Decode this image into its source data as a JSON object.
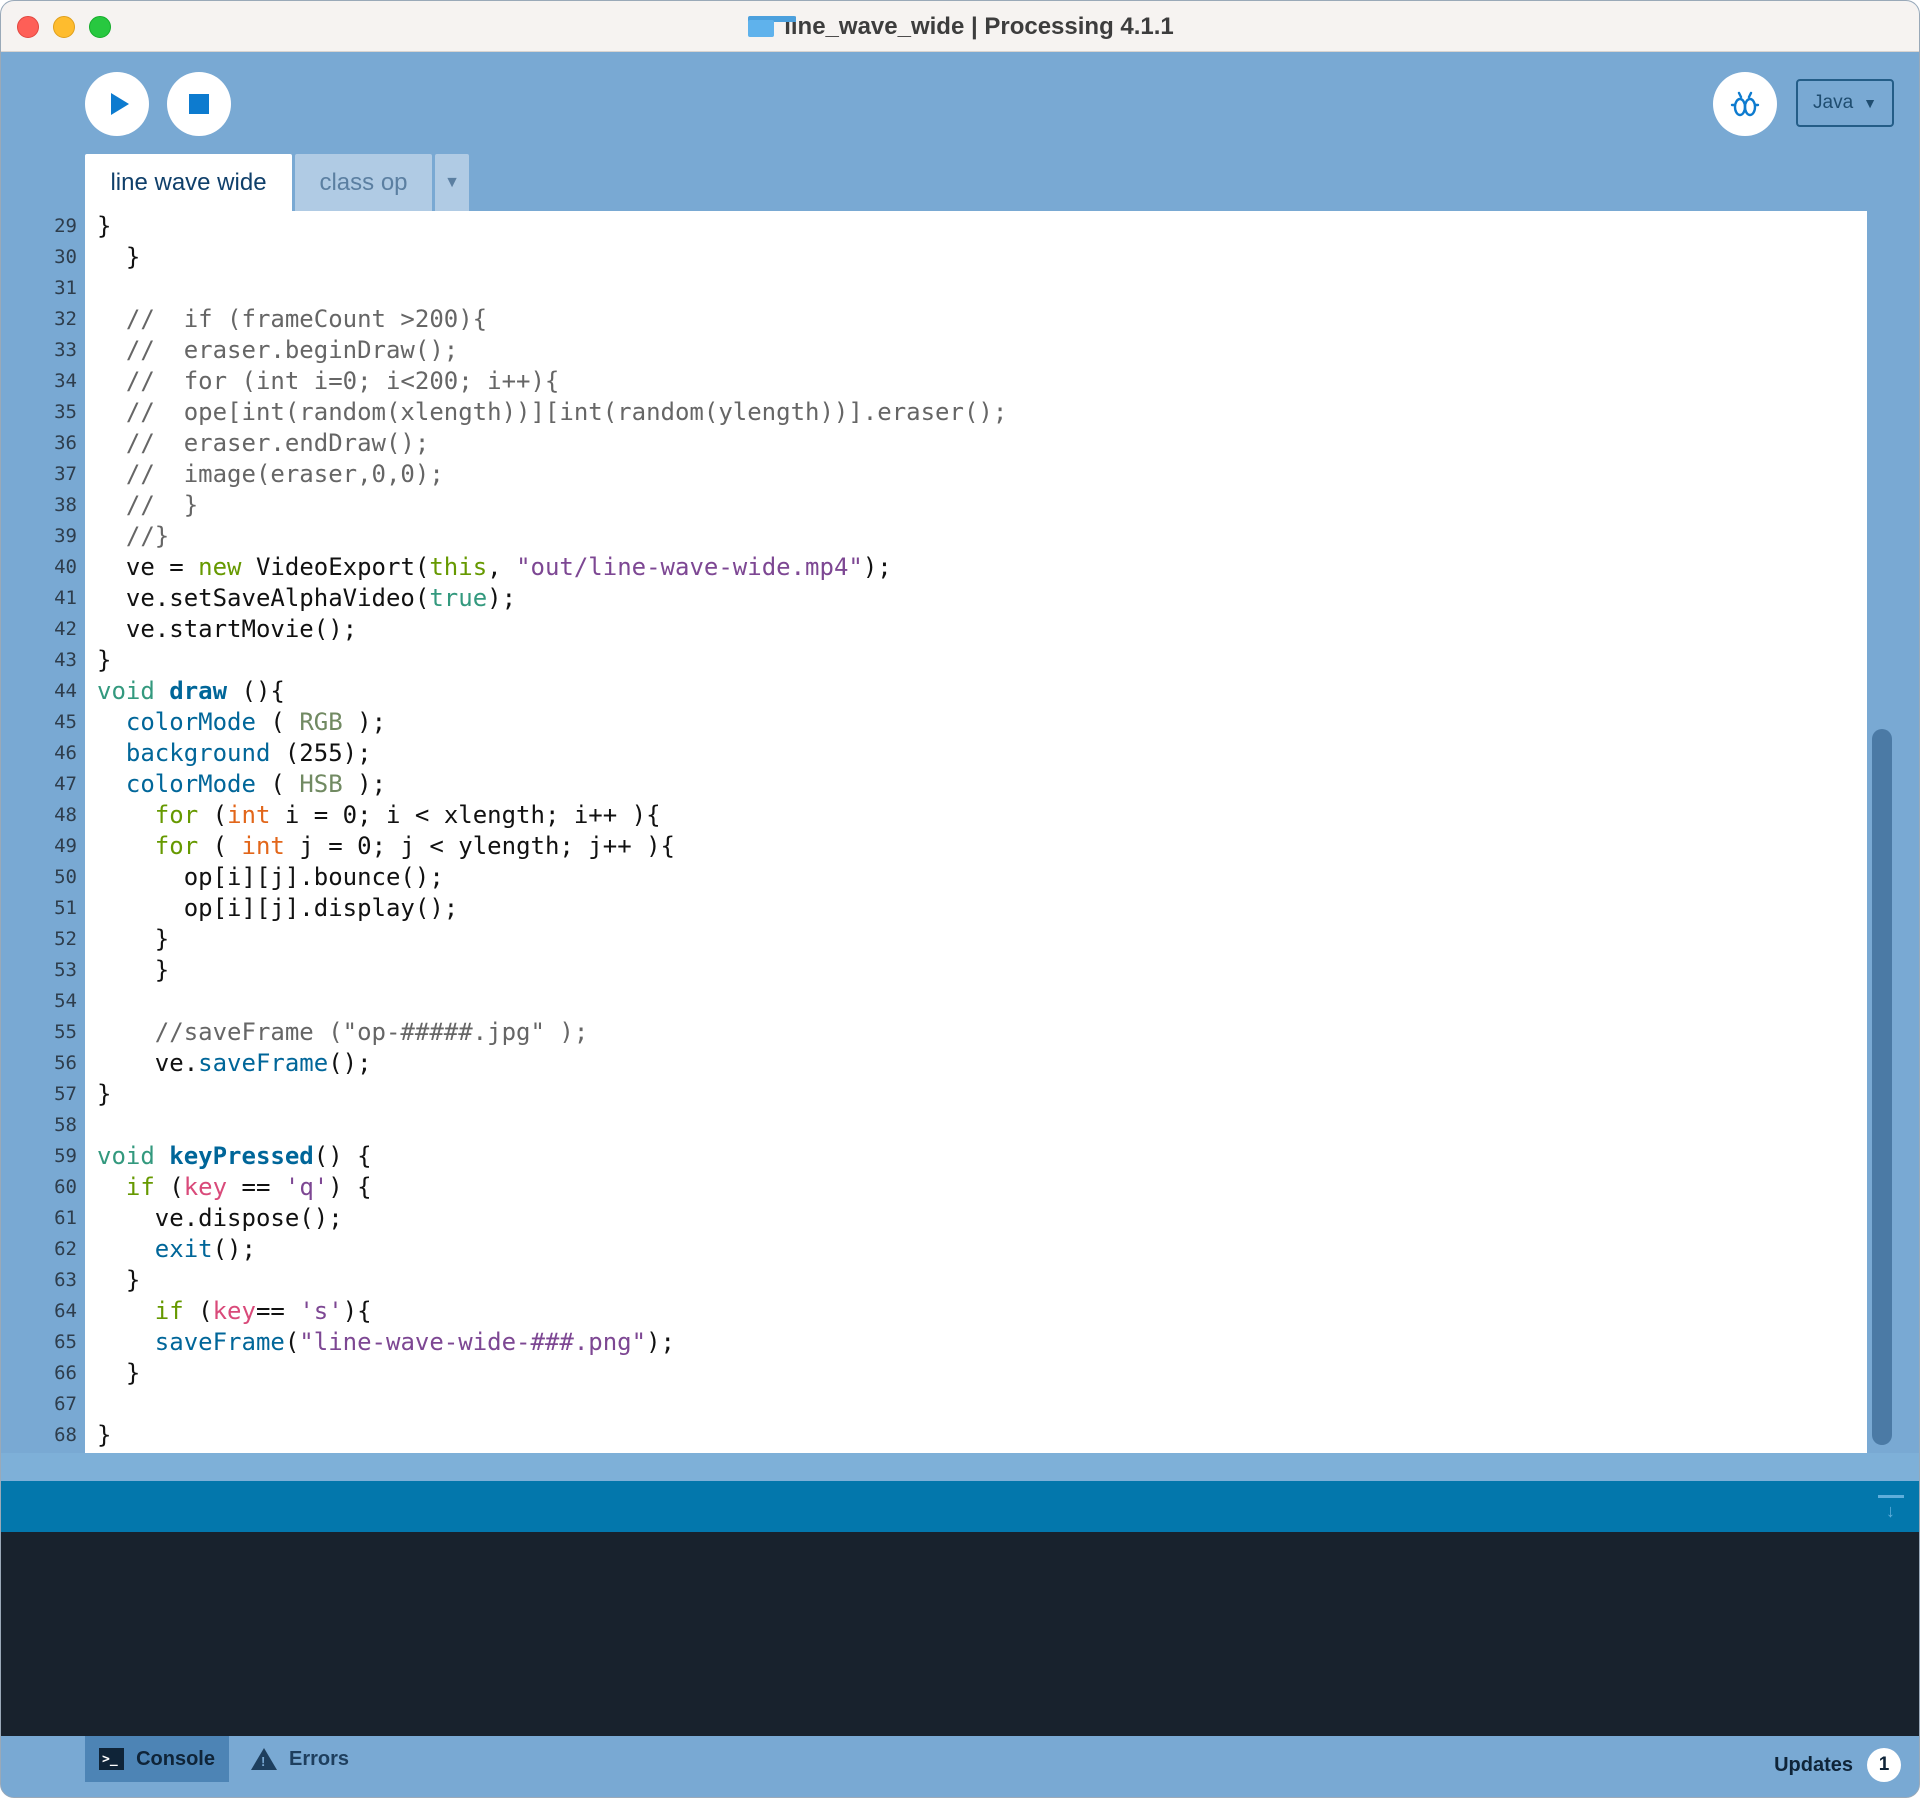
{
  "window": {
    "title": "line_wave_wide | Processing 4.1.1"
  },
  "toolbar": {
    "run_icon": "play-icon",
    "stop_icon": "stop-icon",
    "debug_icon": "debugger-icon",
    "mode_label": "Java",
    "mode_arrow": "▼"
  },
  "tabs": {
    "items": [
      {
        "label": "line wave wide",
        "active": true
      },
      {
        "label": "class op",
        "active": false
      }
    ],
    "menu_arrow": "▼"
  },
  "editor": {
    "lines": [
      {
        "n": "29",
        "segs": [
          {
            "t": "}"
          }
        ]
      },
      {
        "n": "30",
        "segs": [
          {
            "t": "  }"
          }
        ]
      },
      {
        "n": "31",
        "segs": [
          {
            "t": ""
          }
        ]
      },
      {
        "n": "32",
        "segs": [
          {
            "t": "  //  if (frameCount >200){",
            "c": "comment"
          }
        ]
      },
      {
        "n": "33",
        "segs": [
          {
            "t": "  //  eraser.beginDraw();",
            "c": "comment"
          }
        ]
      },
      {
        "n": "34",
        "segs": [
          {
            "t": "  //  for (int i=0; i<200; i++){",
            "c": "comment"
          }
        ]
      },
      {
        "n": "35",
        "segs": [
          {
            "t": "  //  ope[int(random(xlength))][int(random(ylength))].eraser();",
            "c": "comment"
          }
        ]
      },
      {
        "n": "36",
        "segs": [
          {
            "t": "  //  eraser.endDraw();",
            "c": "comment"
          }
        ]
      },
      {
        "n": "37",
        "segs": [
          {
            "t": "  //  image(eraser,0,0);",
            "c": "comment"
          }
        ]
      },
      {
        "n": "38",
        "segs": [
          {
            "t": "  //  }",
            "c": "comment"
          }
        ]
      },
      {
        "n": "39",
        "segs": [
          {
            "t": "  //}",
            "c": "comment"
          }
        ]
      },
      {
        "n": "40",
        "segs": [
          {
            "t": "  ve = "
          },
          {
            "t": "new",
            "c": "kw1"
          },
          {
            "t": " VideoExport("
          },
          {
            "t": "this",
            "c": "kw1"
          },
          {
            "t": ", "
          },
          {
            "t": "\"out/line-wave-wide.mp4\"",
            "c": "str"
          },
          {
            "t": ");"
          }
        ]
      },
      {
        "n": "41",
        "segs": [
          {
            "t": "  ve.setSaveAlphaVideo("
          },
          {
            "t": "true",
            "c": "lit"
          },
          {
            "t": ");"
          }
        ]
      },
      {
        "n": "42",
        "segs": [
          {
            "t": "  ve.startMovie();"
          }
        ]
      },
      {
        "n": "43",
        "segs": [
          {
            "t": "}"
          }
        ]
      },
      {
        "n": "44",
        "segs": [
          {
            "t": "void",
            "c": "kw2"
          },
          {
            "t": " "
          },
          {
            "t": "draw",
            "c": "fnbold"
          },
          {
            "t": " (){"
          }
        ]
      },
      {
        "n": "45",
        "segs": [
          {
            "t": "  "
          },
          {
            "t": "colorMode",
            "c": "fn"
          },
          {
            "t": " ( "
          },
          {
            "t": "RGB",
            "c": "const"
          },
          {
            "t": " );"
          }
        ]
      },
      {
        "n": "46",
        "segs": [
          {
            "t": "  "
          },
          {
            "t": "background",
            "c": "fn"
          },
          {
            "t": " (255);"
          }
        ]
      },
      {
        "n": "47",
        "segs": [
          {
            "t": "  "
          },
          {
            "t": "colorMode",
            "c": "fn"
          },
          {
            "t": " ( "
          },
          {
            "t": "HSB",
            "c": "const"
          },
          {
            "t": " );"
          }
        ]
      },
      {
        "n": "48",
        "segs": [
          {
            "t": "    "
          },
          {
            "t": "for",
            "c": "kw1"
          },
          {
            "t": " ("
          },
          {
            "t": "int",
            "c": "type"
          },
          {
            "t": " i = 0; i < xlength; i++ ){"
          }
        ]
      },
      {
        "n": "49",
        "segs": [
          {
            "t": "    "
          },
          {
            "t": "for",
            "c": "kw1"
          },
          {
            "t": " ( "
          },
          {
            "t": "int",
            "c": "type"
          },
          {
            "t": " j = 0; j < ylength; j++ ){"
          }
        ]
      },
      {
        "n": "50",
        "segs": [
          {
            "t": "      op[i][j].bounce();"
          }
        ]
      },
      {
        "n": "51",
        "segs": [
          {
            "t": "      op[i][j].display();"
          }
        ]
      },
      {
        "n": "52",
        "segs": [
          {
            "t": "    }"
          }
        ]
      },
      {
        "n": "53",
        "segs": [
          {
            "t": "    }"
          }
        ]
      },
      {
        "n": "54",
        "segs": [
          {
            "t": ""
          }
        ]
      },
      {
        "n": "55",
        "segs": [
          {
            "t": "    //saveFrame (\"op-#####.jpg\" );",
            "c": "comment"
          }
        ]
      },
      {
        "n": "56",
        "segs": [
          {
            "t": "    ve."
          },
          {
            "t": "saveFrame",
            "c": "fn"
          },
          {
            "t": "();"
          }
        ]
      },
      {
        "n": "57",
        "segs": [
          {
            "t": "}"
          }
        ]
      },
      {
        "n": "58",
        "segs": [
          {
            "t": ""
          }
        ]
      },
      {
        "n": "59",
        "segs": [
          {
            "t": "void",
            "c": "kw2"
          },
          {
            "t": " "
          },
          {
            "t": "keyPressed",
            "c": "fnbold"
          },
          {
            "t": "() {"
          }
        ]
      },
      {
        "n": "60",
        "segs": [
          {
            "t": "  "
          },
          {
            "t": "if",
            "c": "kw1"
          },
          {
            "t": " ("
          },
          {
            "t": "key",
            "c": "var"
          },
          {
            "t": " == "
          },
          {
            "t": "'q'",
            "c": "str"
          },
          {
            "t": ") {"
          }
        ]
      },
      {
        "n": "61",
        "segs": [
          {
            "t": "    ve.dispose();"
          }
        ]
      },
      {
        "n": "62",
        "segs": [
          {
            "t": "    "
          },
          {
            "t": "exit",
            "c": "fn"
          },
          {
            "t": "();"
          }
        ]
      },
      {
        "n": "63",
        "segs": [
          {
            "t": "  }"
          }
        ]
      },
      {
        "n": "64",
        "segs": [
          {
            "t": "    "
          },
          {
            "t": "if",
            "c": "kw1"
          },
          {
            "t": " ("
          },
          {
            "t": "key",
            "c": "var"
          },
          {
            "t": "== "
          },
          {
            "t": "'s'",
            "c": "str"
          },
          {
            "t": "){"
          }
        ]
      },
      {
        "n": "65",
        "segs": [
          {
            "t": "    "
          },
          {
            "t": "saveFrame",
            "c": "fn"
          },
          {
            "t": "("
          },
          {
            "t": "\"line-wave-wide-###.png\"",
            "c": "str"
          },
          {
            "t": ");"
          }
        ]
      },
      {
        "n": "66",
        "segs": [
          {
            "t": "  }"
          }
        ]
      },
      {
        "n": "67",
        "segs": [
          {
            "t": ""
          }
        ]
      },
      {
        "n": "68",
        "segs": [
          {
            "t": "}"
          }
        ]
      }
    ]
  },
  "syntax_colors": {
    "comment": "#666666",
    "kw1": "#669900",
    "kw2": "#33997e",
    "type": "#e2661a",
    "fn": "#006699",
    "fnbold": "#006699",
    "const": "#718a62",
    "str": "#7d4793",
    "lit": "#33997e",
    "var": "#d94a7a"
  },
  "console": {
    "collapse_icon": "collapse-console-icon"
  },
  "statusbar": {
    "console_tab": "Console",
    "errors_tab": "Errors",
    "updates_label": "Updates",
    "updates_count": "1"
  }
}
